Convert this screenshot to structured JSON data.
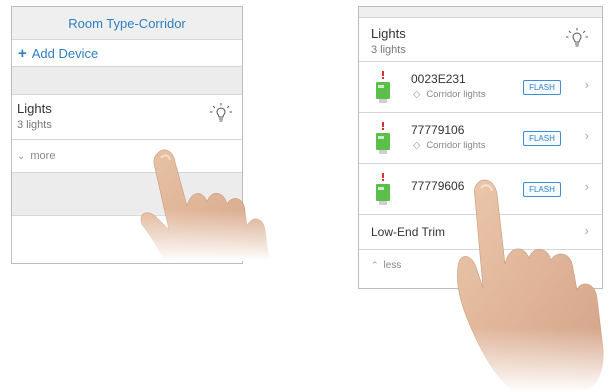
{
  "left_panel": {
    "header": {
      "title": "Room Type-Corridor"
    },
    "add_device": {
      "plus": "+",
      "label": "Add Device"
    },
    "group": {
      "title": "Lights",
      "count": "3 lights",
      "icon": "light-bulb-icon"
    },
    "toggle": {
      "chevron": "⌄",
      "label": "more"
    }
  },
  "right_panel": {
    "group": {
      "title": "Lights",
      "count": "3 lights",
      "icon": "light-bulb-icon"
    },
    "devices": [
      {
        "id": "0023E231",
        "tag_icon": "◇",
        "location": "Corridor lights",
        "action": "FLASH",
        "chevron": "›"
      },
      {
        "id": "77779106",
        "tag_icon": "◇",
        "location": "Corridor lights",
        "action": "FLASH",
        "chevron": "›"
      },
      {
        "id": "77779606",
        "location": "",
        "action": "FLASH",
        "chevron": "›"
      }
    ],
    "trim": {
      "label": "Low-End Trim",
      "chevron": "›"
    },
    "toggle": {
      "chevron": "⌃",
      "label": "less"
    }
  },
  "colors": {
    "accent": "#2c7fc4",
    "device_green": "#5cbf4a",
    "warning_red": "#d9342b"
  }
}
